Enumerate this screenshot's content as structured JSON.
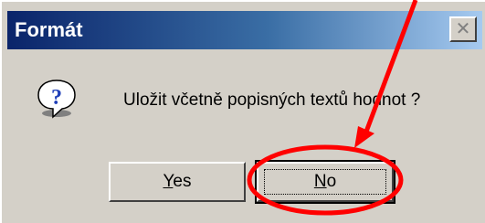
{
  "dialog": {
    "title": "Formát",
    "close_symbol": "✕",
    "icon": "question-icon",
    "message": "Uložit včetně popisných textů hodnot ?",
    "buttons": {
      "yes_label": "Yes",
      "yes_access_key": "Y",
      "no_label": "No",
      "no_access_key": "N"
    }
  },
  "annotation": {
    "color": "#ff0000",
    "shapes": [
      "red-arrow",
      "red-ellipse"
    ]
  },
  "colors": {
    "titlebar_start": "#0a246a",
    "titlebar_end": "#a6caf0",
    "dialog_face": "#d4d0c8",
    "question_icon": "#1f3fb8"
  }
}
